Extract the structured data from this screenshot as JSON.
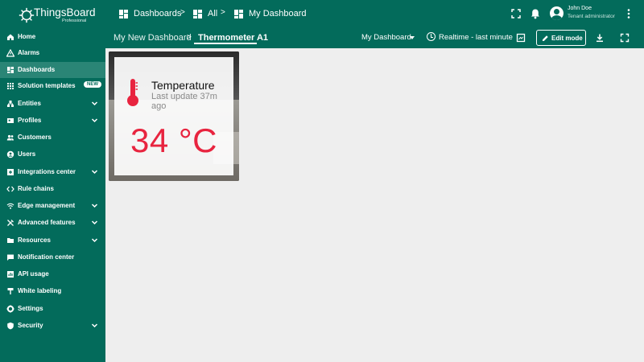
{
  "app": {
    "logo_text": "ThingsBoard",
    "logo_sub": "Professional"
  },
  "breadcrumb": {
    "items": [
      "Dashboards",
      "All",
      "My Dashboard"
    ],
    "separator": ">"
  },
  "user": {
    "name": "John Doe",
    "role": "Tenant administrator"
  },
  "sidebar": {
    "items": [
      {
        "label": "Home",
        "icon": "home-icon"
      },
      {
        "label": "Alarms",
        "icon": "warning-icon"
      },
      {
        "label": "Dashboards",
        "icon": "dashboard-icon",
        "active": true
      },
      {
        "label": "Solution templates",
        "icon": "grid-icon",
        "badge": "NEW"
      },
      {
        "label": "Entities",
        "icon": "entities-icon",
        "expandable": true
      },
      {
        "label": "Profiles",
        "icon": "profiles-icon",
        "expandable": true
      },
      {
        "label": "Customers",
        "icon": "customers-icon"
      },
      {
        "label": "Users",
        "icon": "user-icon"
      },
      {
        "label": "Integrations center",
        "icon": "integrations-icon",
        "expandable": true
      },
      {
        "label": "Rule chains",
        "icon": "code-icon"
      },
      {
        "label": "Edge management",
        "icon": "edge-icon",
        "expandable": true
      },
      {
        "label": "Advanced features",
        "icon": "tools-icon",
        "expandable": true
      },
      {
        "label": "Resources",
        "icon": "folder-icon",
        "expandable": true
      },
      {
        "label": "Notification center",
        "icon": "notification-icon"
      },
      {
        "label": "API usage",
        "icon": "api-icon"
      },
      {
        "label": "White labeling",
        "icon": "paint-icon"
      },
      {
        "label": "Settings",
        "icon": "gear-icon"
      },
      {
        "label": "Security",
        "icon": "shield-icon",
        "expandable": true
      }
    ]
  },
  "toolbar": {
    "dashboard_name": "My New Dashboard",
    "separator": ">",
    "state_name": "Thermometer A1",
    "dashboard_select": "My Dashboard",
    "timewindow": "Realtime - last minute",
    "edit_label": "Edit mode"
  },
  "widget": {
    "title": "Temperature",
    "subtitle": "Last update 37m ago",
    "value": "34 °C",
    "accent_color": "#e8243f"
  },
  "colors": {
    "primary": "#036b5b",
    "active_item": "#2a8576",
    "background": "#eeeeee"
  }
}
